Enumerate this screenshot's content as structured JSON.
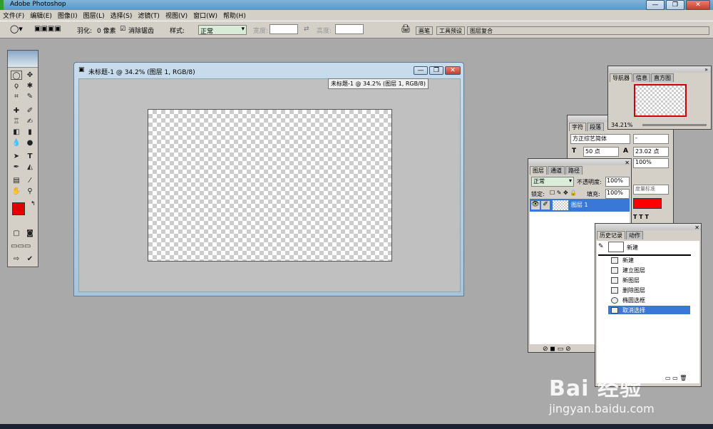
{
  "app": {
    "title": "Adobe Photoshop"
  },
  "window_buttons": {
    "minimize": "—",
    "maximize": "❐",
    "close": "✕"
  },
  "menu": [
    "文件(F)",
    "编辑(E)",
    "图像(I)",
    "图层(L)",
    "选择(S)",
    "滤镜(T)",
    "视图(V)",
    "窗口(W)",
    "帮助(H)"
  ],
  "options": {
    "feather_label": "羽化:",
    "feather_value": "0 像素",
    "antialias_label": "消除锯齿",
    "style_label": "样式:",
    "style_value": "正常",
    "width_label": "宽度:",
    "height_label": "高度:",
    "wells": [
      "画笔",
      "工具预设",
      "图层复合"
    ]
  },
  "document": {
    "title": "未标题-1 @ 34.2% (图层 1, RGB/8)",
    "tooltip": "未标题-1 @ 34.2% (图层 1, RGB/8)"
  },
  "navigator": {
    "tabs": [
      "导航器",
      "信息",
      "直方图"
    ],
    "zoom": "34.21%"
  },
  "character": {
    "tabs": [
      "字符",
      "段落"
    ],
    "font": "方正综艺简体",
    "font_style": "-",
    "size": "50 点",
    "leading": "23.02 点",
    "scale": "100%",
    "aa": "度量标准",
    "color": "#ff0000"
  },
  "layers": {
    "tabs": [
      "图层",
      "通道",
      "路径"
    ],
    "blend": "正常",
    "opacity_label": "不透明度:",
    "opacity": "100%",
    "lock_label": "锁定:",
    "fill_label": "填充:",
    "fill": "100%",
    "layer_name": "图层 1"
  },
  "history": {
    "tabs": [
      "历史记录",
      "动作"
    ],
    "snapshot": "新建",
    "items": [
      "新建",
      "建立图层",
      "新图层",
      "删除图层",
      "椭圆选框",
      "取消选择"
    ]
  },
  "toolbox": {
    "fg_color": "#e00000",
    "bg_color": "#000000"
  },
  "watermark": {
    "brand": "Bai 经验",
    "url": "jingyan.baidu.com"
  }
}
